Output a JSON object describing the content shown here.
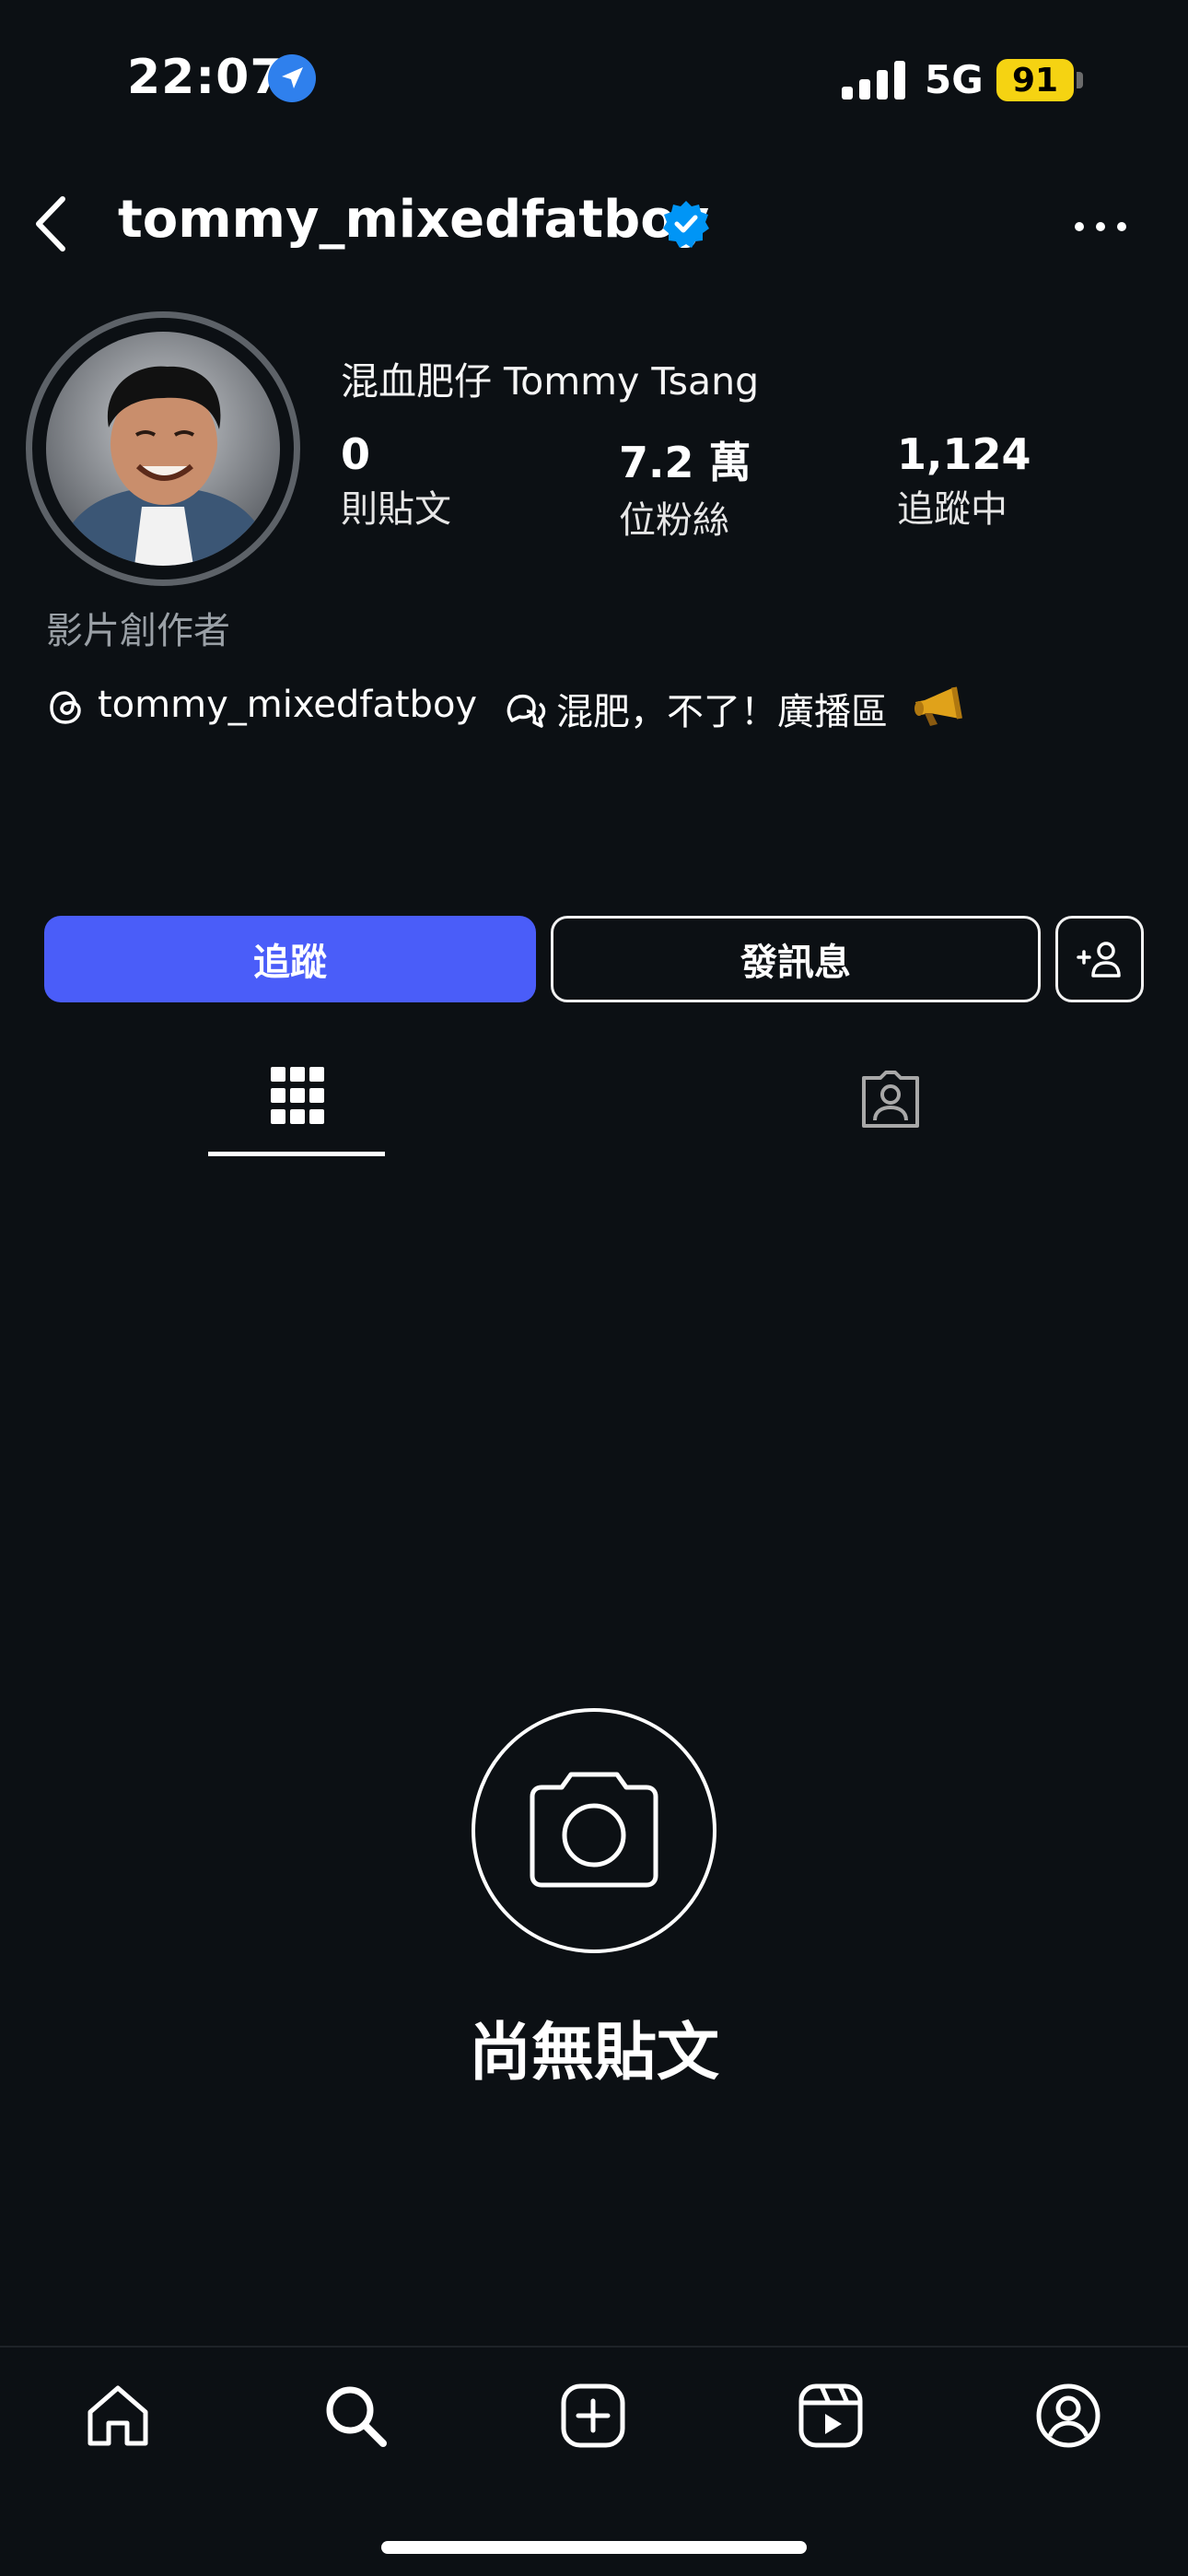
{
  "status_bar": {
    "time": "22:07",
    "network": "5G",
    "battery": "91",
    "battery_color": "#f5d312"
  },
  "header": {
    "username": "tommy_mixedfatboy",
    "back_icon": "chevron-left-icon",
    "verified_icon": "verified-badge-icon",
    "more_icon": "more-horizontal-icon"
  },
  "profile": {
    "full_name": "混血肥仔 Tommy Tsang",
    "stats": [
      {
        "value": "0",
        "label": "則貼文"
      },
      {
        "value": "7.2 萬",
        "label": "位粉絲"
      },
      {
        "value": "1,124",
        "label": "追蹤中"
      }
    ],
    "category": "影片創作者",
    "threads_handle": "tommy_mixedfatboy",
    "channel_text": "混肥，不了！廣播區"
  },
  "actions": {
    "follow_label": "追蹤",
    "message_label": "發訊息",
    "follow_color": "#4a5df9"
  },
  "tabs": [
    {
      "icon": "grid-icon",
      "active": true
    },
    {
      "icon": "tagged-person-icon",
      "active": false
    }
  ],
  "empty_state": {
    "icon": "camera-icon",
    "title": "尚無貼文"
  },
  "bottom_nav": [
    {
      "icon": "home-icon"
    },
    {
      "icon": "search-icon"
    },
    {
      "icon": "create-post-icon"
    },
    {
      "icon": "reels-icon"
    },
    {
      "icon": "profile-icon"
    }
  ]
}
